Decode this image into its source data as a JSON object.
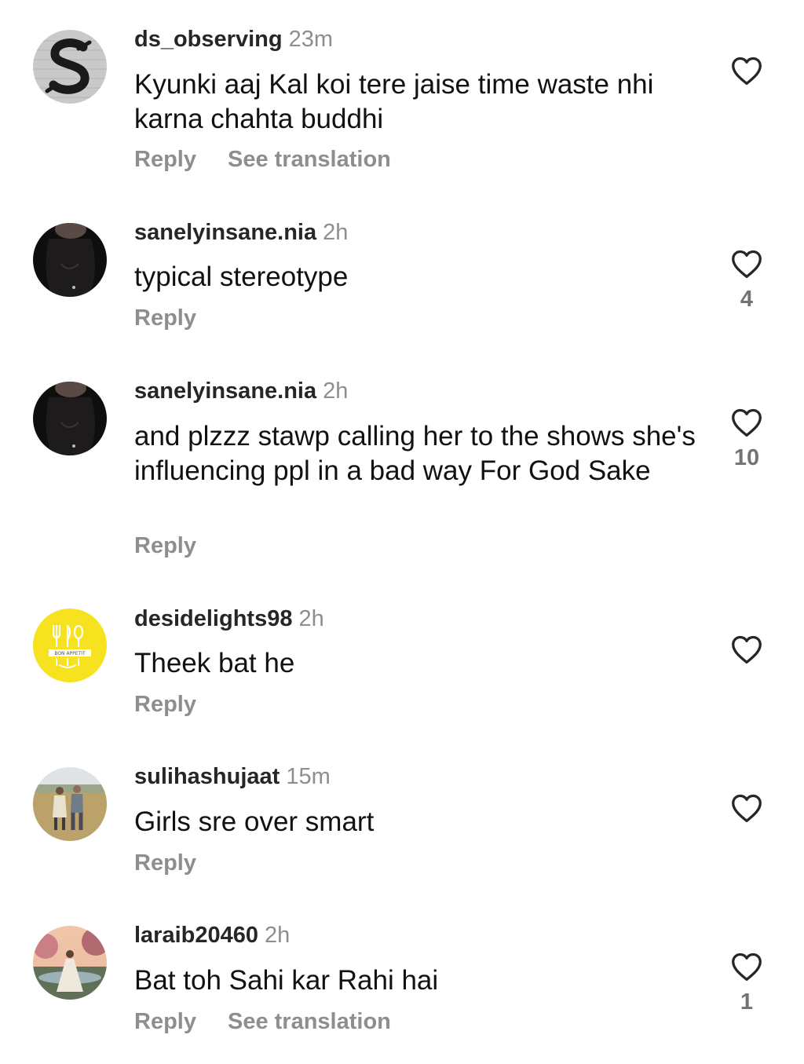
{
  "comments": [
    {
      "username": "ds_observing",
      "time": "23m",
      "text": "Kyunki aaj Kal koi tere jaise time waste nhi karna chahta buddhi",
      "reply_label": "Reply",
      "translation_label": "See translation",
      "likes": "",
      "avatar_icon": "letter-s-avatar-icon"
    },
    {
      "username": "sanelyinsane.nia",
      "time": "2h",
      "text": "typical stereotype",
      "reply_label": "Reply",
      "translation_label": "",
      "likes": "4",
      "avatar_icon": "dark-portrait-avatar-icon"
    },
    {
      "username": "sanelyinsane.nia",
      "time": "2h",
      "text": "and plzzz stawp calling her to the shows she's influencing ppl in a bad way For God Sake",
      "reply_label": "Reply",
      "translation_label": "",
      "likes": "10",
      "avatar_icon": "dark-portrait-avatar-icon"
    },
    {
      "username": "desidelights98",
      "time": "2h",
      "text": "Theek bat he",
      "reply_label": "Reply",
      "translation_label": "",
      "likes": "",
      "avatar_icon": "bon-appetit-avatar-icon",
      "avatar_text": "BON APPETIT"
    },
    {
      "username": "sulihashujaat",
      "time": "15m",
      "text": "Girls sre over smart",
      "reply_label": "Reply",
      "translation_label": "",
      "likes": "",
      "avatar_icon": "couple-photo-avatar-icon"
    },
    {
      "username": "laraib20460",
      "time": "2h",
      "text": "Bat toh Sahi kar Rahi hai",
      "reply_label": "Reply",
      "translation_label": "See translation",
      "likes": "1",
      "avatar_icon": "lady-in-gown-avatar-icon"
    }
  ],
  "colors": {
    "username": "#262626",
    "secondary": "#8e8e8e",
    "text": "#111111",
    "like_outline": "#262626"
  }
}
